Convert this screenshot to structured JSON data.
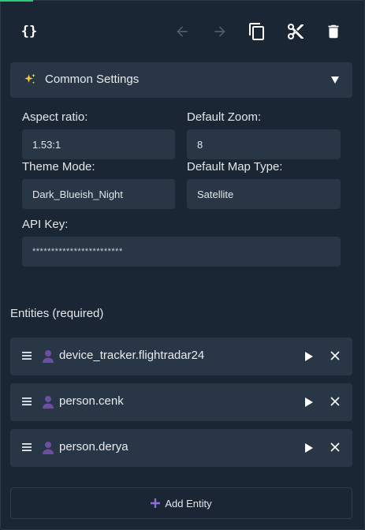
{
  "colors": {
    "background": "#1b2634",
    "panel": "#283645",
    "accent_green": "#2ecc71",
    "person_purple": "#6a4fa3",
    "add_icon_purple": "#8b6fd6"
  },
  "toolbar": {
    "code_label": "{}",
    "icons": [
      "code-icon",
      "undo-arrow-icon",
      "redo-arrow-icon",
      "copy-icon",
      "cut-icon",
      "delete-icon"
    ]
  },
  "common_settings": {
    "title": "Common Settings",
    "icon": "sparkles-icon",
    "expanded": true
  },
  "fields": {
    "aspect_ratio": {
      "label": "Aspect ratio:",
      "value": "1.53:1"
    },
    "default_zoom": {
      "label": "Default Zoom:",
      "value": "8"
    },
    "theme_mode": {
      "label": "Theme Mode:",
      "value": "Dark_Blueish_Night"
    },
    "default_map_type": {
      "label": "Default Map Type:",
      "value": "Satellite"
    },
    "api_key": {
      "label": "API Key:",
      "value": "************************"
    }
  },
  "entities": {
    "title": "Entities (required)",
    "items": [
      {
        "label": "device_tracker.flightradar24"
      },
      {
        "label": "person.cenk"
      },
      {
        "label": "person.derya"
      }
    ],
    "add_label": "Add Entity"
  }
}
